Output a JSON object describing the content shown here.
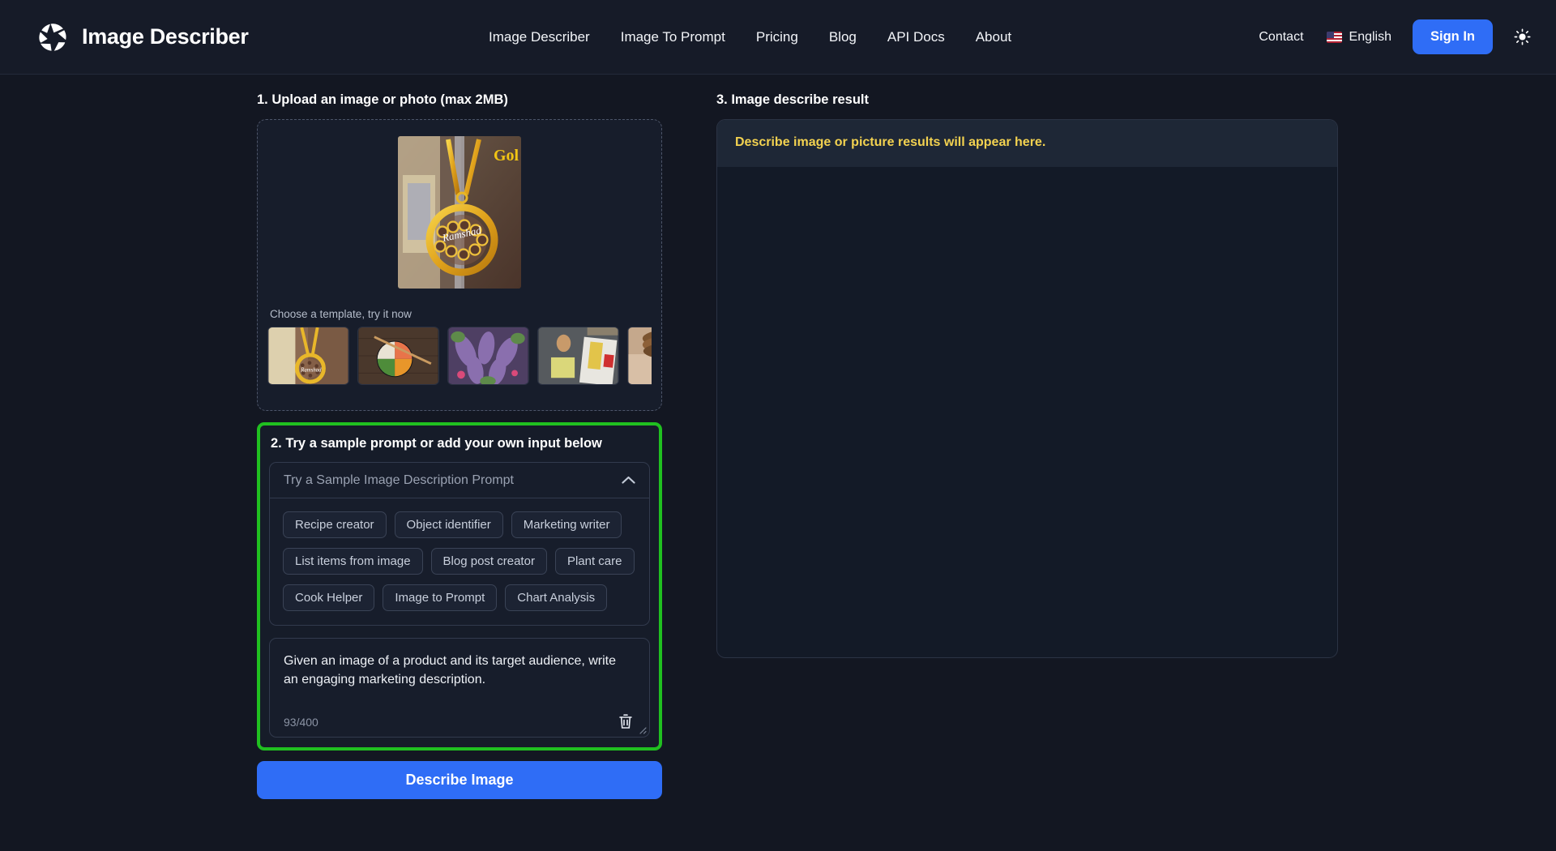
{
  "header": {
    "brand": "Image Describer",
    "logo_icon": "aperture-icon",
    "nav": [
      {
        "label": "Image Describer"
      },
      {
        "label": "Image To Prompt"
      },
      {
        "label": "Pricing"
      },
      {
        "label": "Blog"
      },
      {
        "label": "API Docs"
      },
      {
        "label": "About"
      }
    ],
    "contact": "Contact",
    "language": "English",
    "language_flag": "us-flag-icon",
    "sign_in": "Sign In",
    "theme_toggle_icon": "sun-icon",
    "accent_color": "#2f6df6",
    "background_color": "#161b28"
  },
  "upload": {
    "step_label": "1. Upload an image or photo (max 2MB)",
    "preview_alt": "gold-pendant-necklace-preview",
    "template_label": "Choose a template, try it now",
    "thumbnails": [
      {
        "name": "thumbnail-gold-pendant"
      },
      {
        "name": "thumbnail-food-bowl"
      },
      {
        "name": "thumbnail-purple-plant"
      },
      {
        "name": "thumbnail-udon-package"
      },
      {
        "name": "thumbnail-bagel-stack"
      }
    ]
  },
  "prompt": {
    "step_label": "2. Try a sample prompt or add your own input below",
    "select_placeholder": "Try a Sample Image Description Prompt",
    "chevron_icon": "chevron-up-icon",
    "highlight_color": "#20c020",
    "chips": [
      {
        "label": "Recipe creator"
      },
      {
        "label": "Object identifier"
      },
      {
        "label": "Marketing writer"
      },
      {
        "label": "List items from image"
      },
      {
        "label": "Blog post creator"
      },
      {
        "label": "Plant care"
      },
      {
        "label": "Cook Helper"
      },
      {
        "label": "Image to Prompt"
      },
      {
        "label": "Chart Analysis"
      }
    ],
    "textarea_value": "Given an image of a product and its target audience, write an engaging marketing description.",
    "char_count": "93/400",
    "clear_icon": "trash-icon",
    "submit_label": "Describe Image"
  },
  "result": {
    "step_label": "3. Image describe result",
    "placeholder": "Describe image or picture results will appear here.",
    "placeholder_color": "#f3d250"
  }
}
